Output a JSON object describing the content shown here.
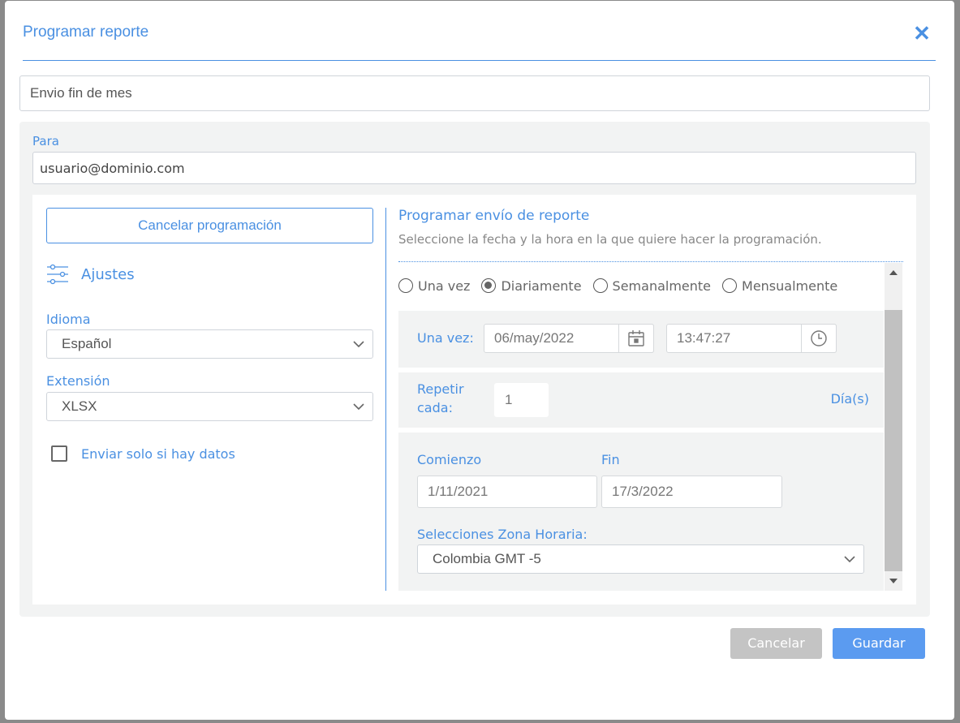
{
  "dialog": {
    "title": "Programar reporte",
    "close_icon": "close-icon",
    "report_name": "Envio fin de mes"
  },
  "recipients": {
    "label": "Para",
    "value": "usuario@dominio.com"
  },
  "left": {
    "cancel_schedule_label": "Cancelar programación",
    "settings_icon": "sliders-icon",
    "settings_label": "Ajustes",
    "language_label": "Idioma",
    "language_value": "Español",
    "extension_label": "Extensión",
    "extension_value": "XLSX",
    "only_if_data_label": "Enviar solo si hay datos",
    "only_if_data_checked": false
  },
  "right": {
    "title": "Programar envío de reporte",
    "subtitle": "Seleccione la fecha y la hora en la que quiere hacer la programación.",
    "frequency_options": [
      {
        "label": "Una vez",
        "checked": false
      },
      {
        "label": "Diariamente",
        "checked": true
      },
      {
        "label": "Semanalmente",
        "checked": false
      },
      {
        "label": "Mensualmente",
        "checked": false
      }
    ],
    "once_label": "Una vez:",
    "date_value": "06/may/2022",
    "time_value": "13:47:27",
    "repeat_label_1": "Repetir",
    "repeat_label_2": "cada:",
    "repeat_value": "1",
    "repeat_unit": "Día(s)",
    "start_label": "Comienzo",
    "start_value": "1/11/2021",
    "end_label": "Fin",
    "end_value": "17/3/2022",
    "timezone_label": "Selecciones Zona Horaria:",
    "timezone_value": "Colombia GMT -5"
  },
  "footer": {
    "cancel_label": "Cancelar",
    "save_label": "Guardar"
  },
  "colors": {
    "accent": "#4a90e2",
    "save_bg": "#5b9bf0",
    "cancel_bg": "#c4c4c4",
    "panel_bg": "#f2f3f3"
  }
}
